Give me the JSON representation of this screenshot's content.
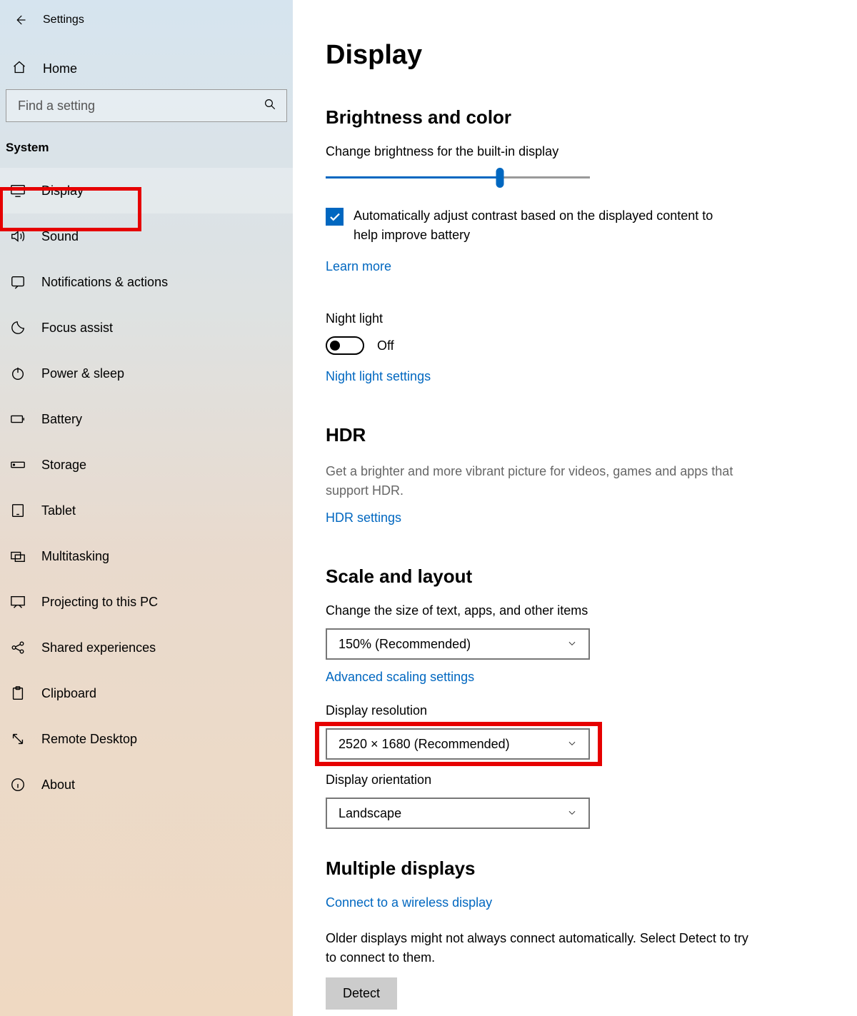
{
  "header": {
    "title": "Settings"
  },
  "sidebar": {
    "home": "Home",
    "search_placeholder": "Find a setting",
    "category": "System",
    "items": [
      {
        "label": "Display",
        "selected": true
      },
      {
        "label": "Sound"
      },
      {
        "label": "Notifications & actions"
      },
      {
        "label": "Focus assist"
      },
      {
        "label": "Power & sleep"
      },
      {
        "label": "Battery"
      },
      {
        "label": "Storage"
      },
      {
        "label": "Tablet"
      },
      {
        "label": "Multitasking"
      },
      {
        "label": "Projecting to this PC"
      },
      {
        "label": "Shared experiences"
      },
      {
        "label": "Clipboard"
      },
      {
        "label": "Remote Desktop"
      },
      {
        "label": "About"
      }
    ]
  },
  "main": {
    "page_title": "Display",
    "brightness": {
      "heading": "Brightness and color",
      "slider_label": "Change brightness for the built-in display",
      "auto_contrast": "Automatically adjust contrast based on the displayed content to help improve battery",
      "learn_more": "Learn more",
      "night_light_label": "Night light",
      "night_light_state": "Off",
      "night_light_settings": "Night light settings"
    },
    "hdr": {
      "heading": "HDR",
      "desc": "Get a brighter and more vibrant picture for videos, games and apps that support HDR.",
      "link": "HDR settings"
    },
    "scale": {
      "heading": "Scale and layout",
      "size_label": "Change the size of text, apps, and other items",
      "size_value": "150% (Recommended)",
      "advanced": "Advanced scaling settings",
      "res_label": "Display resolution",
      "res_value": "2520 × 1680 (Recommended)",
      "orient_label": "Display orientation",
      "orient_value": "Landscape"
    },
    "multiple": {
      "heading": "Multiple displays",
      "wireless": "Connect to a wireless display",
      "older": "Older displays might not always connect automatically. Select Detect to try to connect to them.",
      "detect": "Detect"
    }
  }
}
